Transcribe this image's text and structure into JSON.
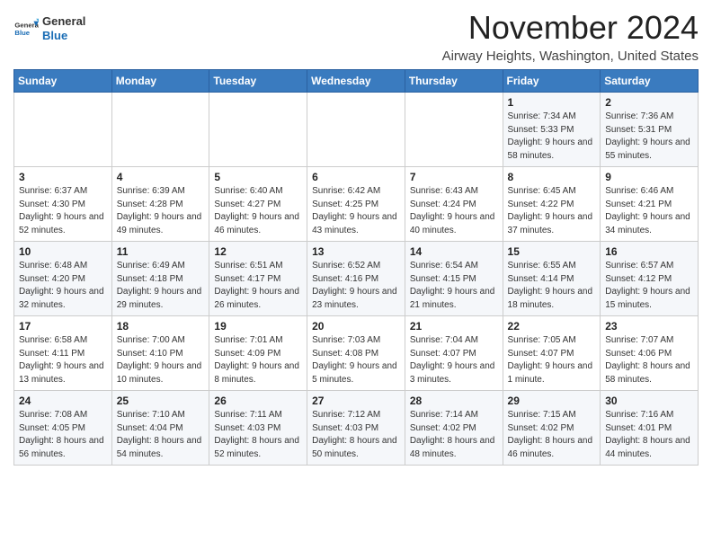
{
  "header": {
    "logo": {
      "general": "General",
      "blue": "Blue"
    },
    "title": "November 2024",
    "location": "Airway Heights, Washington, United States"
  },
  "days_of_week": [
    "Sunday",
    "Monday",
    "Tuesday",
    "Wednesday",
    "Thursday",
    "Friday",
    "Saturday"
  ],
  "weeks": [
    [
      {
        "day": "",
        "info": ""
      },
      {
        "day": "",
        "info": ""
      },
      {
        "day": "",
        "info": ""
      },
      {
        "day": "",
        "info": ""
      },
      {
        "day": "",
        "info": ""
      },
      {
        "day": "1",
        "info": "Sunrise: 7:34 AM\nSunset: 5:33 PM\nDaylight: 9 hours and 58 minutes."
      },
      {
        "day": "2",
        "info": "Sunrise: 7:36 AM\nSunset: 5:31 PM\nDaylight: 9 hours and 55 minutes."
      }
    ],
    [
      {
        "day": "3",
        "info": "Sunrise: 6:37 AM\nSunset: 4:30 PM\nDaylight: 9 hours and 52 minutes."
      },
      {
        "day": "4",
        "info": "Sunrise: 6:39 AM\nSunset: 4:28 PM\nDaylight: 9 hours and 49 minutes."
      },
      {
        "day": "5",
        "info": "Sunrise: 6:40 AM\nSunset: 4:27 PM\nDaylight: 9 hours and 46 minutes."
      },
      {
        "day": "6",
        "info": "Sunrise: 6:42 AM\nSunset: 4:25 PM\nDaylight: 9 hours and 43 minutes."
      },
      {
        "day": "7",
        "info": "Sunrise: 6:43 AM\nSunset: 4:24 PM\nDaylight: 9 hours and 40 minutes."
      },
      {
        "day": "8",
        "info": "Sunrise: 6:45 AM\nSunset: 4:22 PM\nDaylight: 9 hours and 37 minutes."
      },
      {
        "day": "9",
        "info": "Sunrise: 6:46 AM\nSunset: 4:21 PM\nDaylight: 9 hours and 34 minutes."
      }
    ],
    [
      {
        "day": "10",
        "info": "Sunrise: 6:48 AM\nSunset: 4:20 PM\nDaylight: 9 hours and 32 minutes."
      },
      {
        "day": "11",
        "info": "Sunrise: 6:49 AM\nSunset: 4:18 PM\nDaylight: 9 hours and 29 minutes."
      },
      {
        "day": "12",
        "info": "Sunrise: 6:51 AM\nSunset: 4:17 PM\nDaylight: 9 hours and 26 minutes."
      },
      {
        "day": "13",
        "info": "Sunrise: 6:52 AM\nSunset: 4:16 PM\nDaylight: 9 hours and 23 minutes."
      },
      {
        "day": "14",
        "info": "Sunrise: 6:54 AM\nSunset: 4:15 PM\nDaylight: 9 hours and 21 minutes."
      },
      {
        "day": "15",
        "info": "Sunrise: 6:55 AM\nSunset: 4:14 PM\nDaylight: 9 hours and 18 minutes."
      },
      {
        "day": "16",
        "info": "Sunrise: 6:57 AM\nSunset: 4:12 PM\nDaylight: 9 hours and 15 minutes."
      }
    ],
    [
      {
        "day": "17",
        "info": "Sunrise: 6:58 AM\nSunset: 4:11 PM\nDaylight: 9 hours and 13 minutes."
      },
      {
        "day": "18",
        "info": "Sunrise: 7:00 AM\nSunset: 4:10 PM\nDaylight: 9 hours and 10 minutes."
      },
      {
        "day": "19",
        "info": "Sunrise: 7:01 AM\nSunset: 4:09 PM\nDaylight: 9 hours and 8 minutes."
      },
      {
        "day": "20",
        "info": "Sunrise: 7:03 AM\nSunset: 4:08 PM\nDaylight: 9 hours and 5 minutes."
      },
      {
        "day": "21",
        "info": "Sunrise: 7:04 AM\nSunset: 4:07 PM\nDaylight: 9 hours and 3 minutes."
      },
      {
        "day": "22",
        "info": "Sunrise: 7:05 AM\nSunset: 4:07 PM\nDaylight: 9 hours and 1 minute."
      },
      {
        "day": "23",
        "info": "Sunrise: 7:07 AM\nSunset: 4:06 PM\nDaylight: 8 hours and 58 minutes."
      }
    ],
    [
      {
        "day": "24",
        "info": "Sunrise: 7:08 AM\nSunset: 4:05 PM\nDaylight: 8 hours and 56 minutes."
      },
      {
        "day": "25",
        "info": "Sunrise: 7:10 AM\nSunset: 4:04 PM\nDaylight: 8 hours and 54 minutes."
      },
      {
        "day": "26",
        "info": "Sunrise: 7:11 AM\nSunset: 4:03 PM\nDaylight: 8 hours and 52 minutes."
      },
      {
        "day": "27",
        "info": "Sunrise: 7:12 AM\nSunset: 4:03 PM\nDaylight: 8 hours and 50 minutes."
      },
      {
        "day": "28",
        "info": "Sunrise: 7:14 AM\nSunset: 4:02 PM\nDaylight: 8 hours and 48 minutes."
      },
      {
        "day": "29",
        "info": "Sunrise: 7:15 AM\nSunset: 4:02 PM\nDaylight: 8 hours and 46 minutes."
      },
      {
        "day": "30",
        "info": "Sunrise: 7:16 AM\nSunset: 4:01 PM\nDaylight: 8 hours and 44 minutes."
      }
    ]
  ]
}
